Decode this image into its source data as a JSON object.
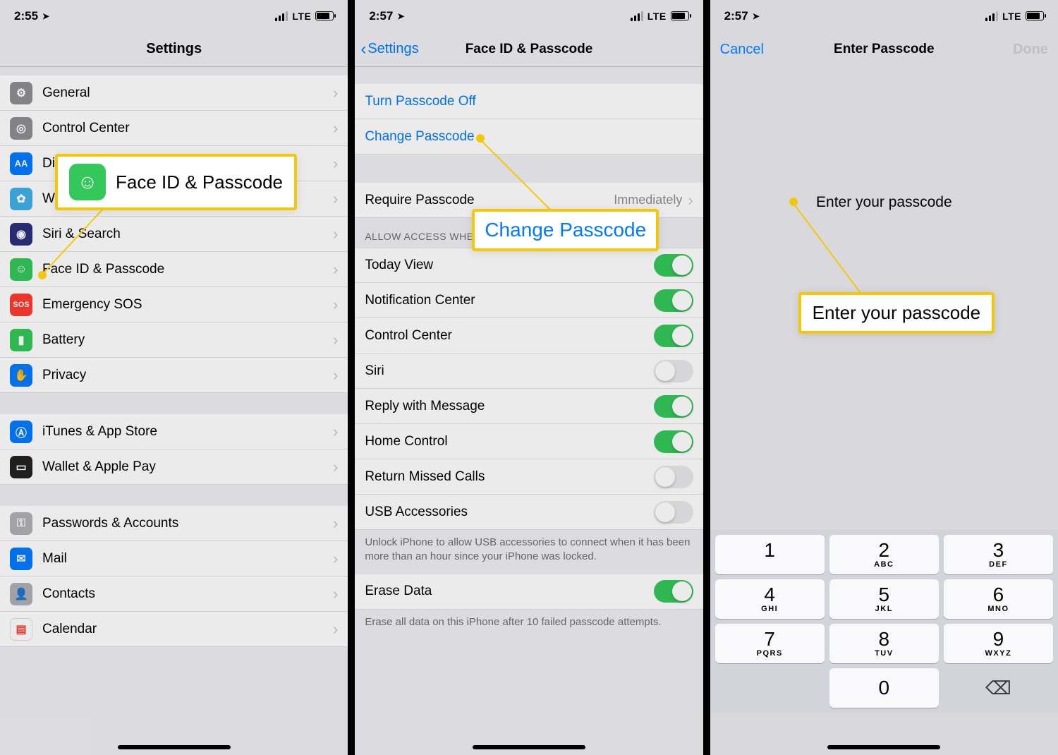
{
  "phone1": {
    "time": "2:55",
    "network": "LTE",
    "title": "Settings",
    "items": [
      {
        "icon": "gear",
        "bg": "gray",
        "label": "General"
      },
      {
        "icon": "cc",
        "bg": "gray",
        "label": "Control Center"
      },
      {
        "icon": "aa",
        "bg": "blueA",
        "label": "Display & Brightness"
      },
      {
        "icon": "wp",
        "bg": "aqua",
        "label": "Wallpaper"
      },
      {
        "icon": "siri",
        "bg": "darkblue",
        "label": "Siri & Search"
      },
      {
        "icon": "face",
        "bg": "green",
        "label": "Face ID & Passcode"
      },
      {
        "icon": "sos",
        "bg": "red",
        "label": "Emergency SOS"
      },
      {
        "icon": "batt",
        "bg": "green",
        "label": "Battery"
      },
      {
        "icon": "hand",
        "bg": "blue",
        "label": "Privacy"
      }
    ],
    "group2": [
      {
        "icon": "as",
        "bg": "blue",
        "label": "iTunes & App Store"
      },
      {
        "icon": "wal",
        "bg": "gray",
        "label": "Wallet & Apple Pay"
      }
    ],
    "group3": [
      {
        "icon": "key",
        "bg": "lgray",
        "label": "Passwords & Accounts"
      },
      {
        "icon": "mail",
        "bg": "blue",
        "label": "Mail"
      },
      {
        "icon": "ct",
        "bg": "lgray",
        "label": "Contacts"
      },
      {
        "icon": "cal",
        "bg": "red",
        "label": "Calendar"
      }
    ],
    "callout": "Face ID & Passcode"
  },
  "phone2": {
    "time": "2:57",
    "network": "LTE",
    "back": "Settings",
    "title": "Face ID & Passcode",
    "links": [
      "Turn Passcode Off",
      "Change Passcode"
    ],
    "require_label": "Require Passcode",
    "require_val": "Immediately",
    "section_header": "ALLOW ACCESS WHEN LOCKED:",
    "toggles": [
      {
        "label": "Today View",
        "on": true
      },
      {
        "label": "Notification Center",
        "on": true
      },
      {
        "label": "Control Center",
        "on": true
      },
      {
        "label": "Siri",
        "on": false
      },
      {
        "label": "Reply with Message",
        "on": true
      },
      {
        "label": "Home Control",
        "on": true
      },
      {
        "label": "Return Missed Calls",
        "on": false
      },
      {
        "label": "USB Accessories",
        "on": false
      }
    ],
    "footer1": "Unlock iPhone to allow USB accessories to connect when it has been more than an hour since your iPhone was locked.",
    "erase": "Erase Data",
    "erase_on": true,
    "footer2": "Erase all data on this iPhone after 10 failed passcode attempts.",
    "callout": "Change Passcode"
  },
  "phone3": {
    "time": "2:57",
    "network": "LTE",
    "cancel": "Cancel",
    "title": "Enter Passcode",
    "done": "Done",
    "prompt": "Enter your passcode",
    "callout": "Enter your passcode",
    "keys": [
      {
        "d": "1",
        "l": ""
      },
      {
        "d": "2",
        "l": "ABC"
      },
      {
        "d": "3",
        "l": "DEF"
      },
      {
        "d": "4",
        "l": "GHI"
      },
      {
        "d": "5",
        "l": "JKL"
      },
      {
        "d": "6",
        "l": "MNO"
      },
      {
        "d": "7",
        "l": "PQRS"
      },
      {
        "d": "8",
        "l": "TUV"
      },
      {
        "d": "9",
        "l": "WXYZ"
      }
    ],
    "zero": "0"
  }
}
